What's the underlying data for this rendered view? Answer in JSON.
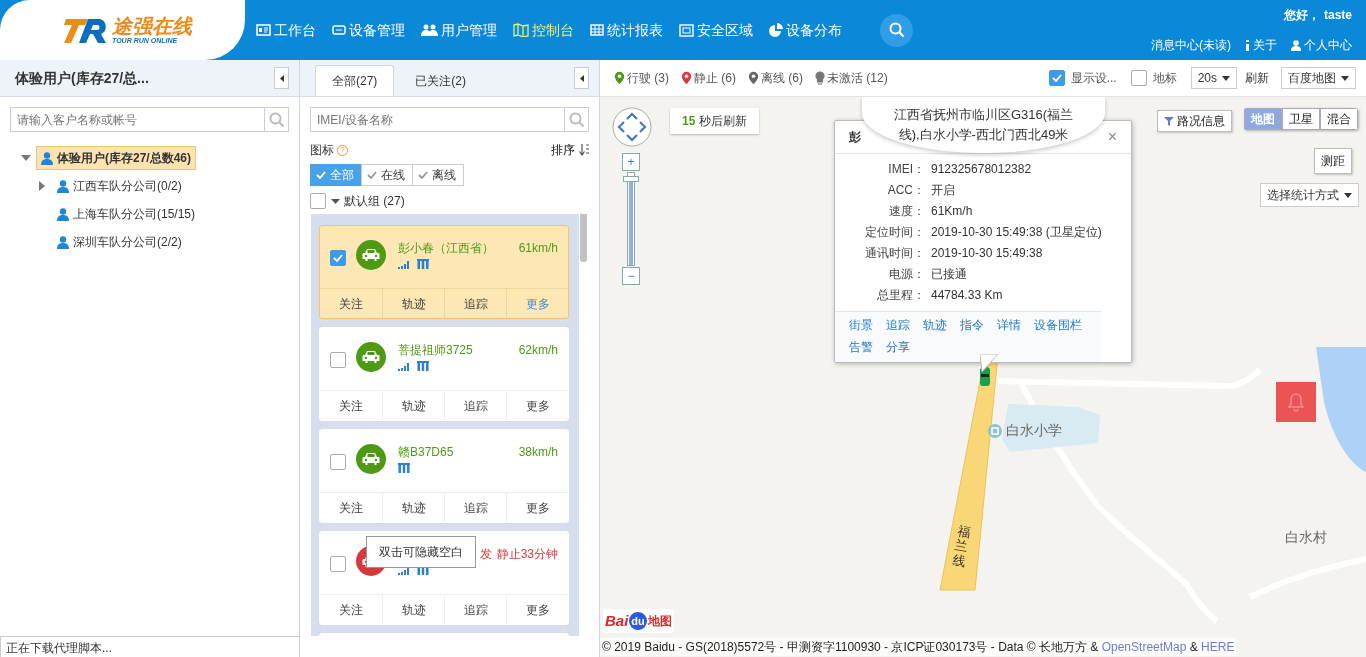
{
  "header": {
    "logo": {
      "title": "途强在线",
      "subtitle": "TOUR RUN ONLINE"
    },
    "nav": [
      {
        "label": "工作台",
        "selected": false
      },
      {
        "label": "设备管理",
        "selected": false
      },
      {
        "label": "用户管理",
        "selected": false
      },
      {
        "label": "控制台",
        "selected": true
      },
      {
        "label": "统计报表",
        "selected": false
      },
      {
        "label": "安全区域",
        "selected": false
      },
      {
        "label": "设备分布",
        "selected": false
      }
    ],
    "greeting": "您好，",
    "user": "taste",
    "links": [
      "消息中心(未读)",
      "关于",
      "个人中心"
    ]
  },
  "customers": {
    "title": "体验用户(库存27/总...",
    "search_placeholder": "请输入客户名称或帐号",
    "tree": [
      {
        "label": "体验用户(库存27/总数46)",
        "selected": true,
        "expanded": true,
        "children": [
          {
            "label": "江西车队分公司(0/2)",
            "selected": false,
            "expanded": false
          },
          {
            "label": "上海车队分公司(15/15)",
            "selected": false
          },
          {
            "label": "深圳车队分公司(2/2)",
            "selected": false
          }
        ]
      }
    ]
  },
  "devices": {
    "tabs": [
      {
        "label": "全部(27)",
        "selected": true
      },
      {
        "label": "已关注(2)",
        "selected": false
      }
    ],
    "search_placeholder": "IMEI/设备名称",
    "icon_label": "图标",
    "help": "?",
    "sort_label": "排序",
    "filters": [
      {
        "label": "全部",
        "selected": true
      },
      {
        "label": "在线",
        "selected": false
      },
      {
        "label": "离线",
        "selected": false
      }
    ],
    "group": {
      "label": "默认组 (27)",
      "checked": false,
      "expanded": true
    },
    "cards": [
      {
        "kind": "moving",
        "checked": true,
        "selected": true,
        "name": "彭小春（江西省）",
        "reading": "61km/h",
        "signal": true,
        "battery": true,
        "actions": [
          {
            "label": "关注",
            "hover": false
          },
          {
            "label": "轨迹",
            "hover": false
          },
          {
            "label": "追踪",
            "hover": false
          },
          {
            "label": "更多",
            "hover": true
          }
        ]
      },
      {
        "kind": "moving",
        "checked": false,
        "selected": false,
        "name": "菩提祖师3725",
        "reading": "62km/h",
        "signal": true,
        "battery": true,
        "actions": [
          {
            "label": "关注",
            "hover": false
          },
          {
            "label": "轨迹",
            "hover": false
          },
          {
            "label": "追踪",
            "hover": false
          },
          {
            "label": "更多",
            "hover": false
          }
        ]
      },
      {
        "kind": "moving",
        "checked": false,
        "selected": false,
        "name": "赣B37D65",
        "reading": "38km/h",
        "signal": false,
        "battery": true,
        "actions": [
          {
            "label": "关注",
            "hover": false
          },
          {
            "label": "轨迹",
            "hover": false
          },
          {
            "label": "追踪",
            "hover": false
          },
          {
            "label": "更多",
            "hover": false
          }
        ]
      },
      {
        "kind": "stopped",
        "checked": false,
        "selected": false,
        "name": "发",
        "reading": "静止33分钟",
        "signal": true,
        "battery": true,
        "tooltip": "双击可隐藏空白",
        "actions": [
          {
            "label": "关注",
            "hover": false
          },
          {
            "label": "轨迹",
            "hover": false
          },
          {
            "label": "追踪",
            "hover": false
          },
          {
            "label": "更多",
            "hover": false
          }
        ]
      },
      {
        "kind": "stub"
      }
    ]
  },
  "map": {
    "legend": [
      {
        "label": "行驶",
        "count": "(3)",
        "kind": "pin",
        "color": "#4e9a15"
      },
      {
        "label": "静止",
        "count": "(6)",
        "kind": "pin",
        "color": "#e0393e"
      },
      {
        "label": "离线",
        "count": "(6)",
        "kind": "pin",
        "color": "#666666"
      },
      {
        "label": "未激活",
        "count": "(12)",
        "kind": "bulb",
        "color": "#777777"
      }
    ],
    "show_device": {
      "label": "显示设...",
      "checked": true
    },
    "landmark": {
      "label": "地标",
      "checked": false
    },
    "interval": "20s",
    "refresh_label": "刷新",
    "map_source": "百度地图",
    "countdown": {
      "value": "15",
      "text": "秒后刷新"
    },
    "zoom": {
      "zoom_in": "+",
      "level": 0.97,
      "zoom_out": "−"
    },
    "traffic": "路况信息",
    "map_types": [
      {
        "label": "地图",
        "selected": true
      },
      {
        "label": "卫星",
        "selected": false
      },
      {
        "label": "混合",
        "selected": false
      }
    ],
    "measure": "测距",
    "stats_select": "选择统计方式",
    "info_window": {
      "title": "彭",
      "close": "×",
      "address": "江西省抚州市临川区G316(福兰线),白水小学-西北门西北49米",
      "rows": [
        {
          "label": "IMEI：",
          "value": "912325678012382"
        },
        {
          "label": "ACC：",
          "value": "开启"
        },
        {
          "label": "速度：",
          "value": "61Km/h"
        },
        {
          "label": "定位时间：",
          "value": "2019-10-30 15:49:38 (卫星定位)"
        },
        {
          "label": "通讯时间：",
          "value": "2019-10-30 15:49:38"
        },
        {
          "label": "电源：",
          "value": "已接通"
        },
        {
          "label": "总里程：",
          "value": "44784.33 Km"
        }
      ],
      "links": [
        "街景",
        "追踪",
        "轨迹",
        "指令",
        "详情",
        "设备围栏",
        "告警",
        "分享"
      ]
    },
    "places": [
      {
        "label": "白水小学",
        "kind": "school"
      },
      {
        "label": "白水村",
        "kind": "village"
      },
      {
        "label": "福兰线",
        "kind": "road"
      }
    ],
    "logo": {
      "left": "Bai",
      "badge": "du",
      "right": "地图"
    },
    "attribution": [
      {
        "kind": "text",
        "text": "© 2019 Baidu - GS(2018)5572号 - 甲测资字1100930 - 京ICP证030173号 - Data © 长地万方 & "
      },
      {
        "kind": "link",
        "text": "OpenStreetMap"
      },
      {
        "kind": "text",
        "text": " & "
      },
      {
        "kind": "link",
        "text": "HERE"
      }
    ]
  },
  "status_bar": "正在下载代理脚本..."
}
